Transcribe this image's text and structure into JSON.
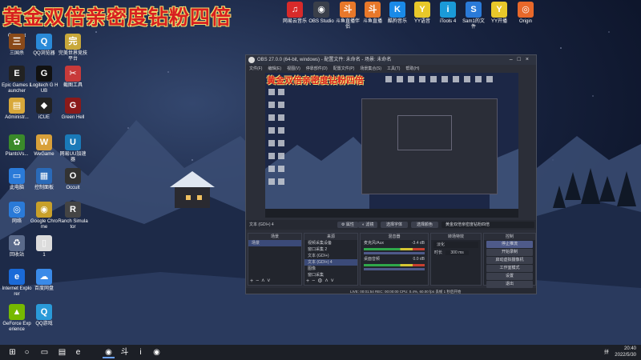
{
  "overlay_title": "黄金双倍亲密度钻粉四倍",
  "desktop_left": [
    {
      "label": "Connect",
      "icon": "connect-icon",
      "glyph": "",
      "color": "#3a3f4a"
    },
    {
      "label": "三国杀",
      "icon": "sanguosha-icon",
      "glyph": "三",
      "color": "#8a4a1a"
    },
    {
      "label": "QQ浏览器",
      "icon": "qq-browser-icon",
      "glyph": "Q",
      "color": "#2a8ad8"
    },
    {
      "label": "完美世界竞技平台",
      "icon": "perfect-world-icon",
      "glyph": "完",
      "color": "#c8a83a"
    },
    {
      "label": "Epic Games Launcher",
      "icon": "epic-games-icon",
      "glyph": "E",
      "color": "#222"
    },
    {
      "label": "Logitech G HUB",
      "icon": "logitech-ghub-icon",
      "glyph": "G",
      "color": "#111"
    },
    {
      "label": "截图工具",
      "icon": "snipping-tool-icon",
      "glyph": "✂",
      "color": "#c83a3a"
    },
    {
      "label": "Administr...",
      "icon": "user-folder-icon",
      "glyph": "▤",
      "color": "#d8a83a"
    },
    {
      "label": "iCUE",
      "icon": "icue-icon",
      "glyph": "◆",
      "color": "#222"
    },
    {
      "label": "Green Hell",
      "icon": "green-hell-icon",
      "glyph": "G",
      "color": "#8a1a1a"
    },
    {
      "label": "PlantsVs...",
      "icon": "plants-vs-zombies-icon",
      "glyph": "✿",
      "color": "#3a8a2a"
    },
    {
      "label": "WeGame",
      "icon": "wegame-icon",
      "glyph": "W",
      "color": "#d8a03a"
    },
    {
      "label": "网易UU加速器",
      "icon": "uu-accelerator-icon",
      "glyph": "U",
      "color": "#1a7ab8"
    },
    {
      "label": "此电脑",
      "icon": "this-pc-icon",
      "glyph": "▭",
      "color": "#2a7ad8"
    },
    {
      "label": "控制面板",
      "icon": "control-panel-icon",
      "glyph": "▦",
      "color": "#2a6ab8"
    },
    {
      "label": "Occult",
      "icon": "occult-icon",
      "glyph": "O",
      "color": "#333"
    },
    {
      "label": "网络",
      "icon": "network-icon",
      "glyph": "◎",
      "color": "#2a7ad8"
    },
    {
      "label": "Google Chrome",
      "icon": "chrome-icon",
      "glyph": "◉",
      "color": "#c8a02a"
    },
    {
      "label": "Ranch Simulator",
      "icon": "ranch-simulator-icon",
      "glyph": "R",
      "color": "#444"
    },
    {
      "label": "回收站",
      "icon": "recycle-bin-icon",
      "glyph": "♻",
      "color": "#5a6a8a"
    },
    {
      "label": "1",
      "icon": "file-icon",
      "glyph": "▯",
      "color": "#dcdcdc"
    },
    {
      "label": "Internet Explorer",
      "icon": "internet-explorer-icon",
      "glyph": "e",
      "color": "#1a6ad8"
    },
    {
      "label": "百度网盘",
      "icon": "baidu-netdisk-icon",
      "glyph": "☁",
      "color": "#3a8ae8"
    },
    {
      "label": "GeForce Experience",
      "icon": "geforce-icon",
      "glyph": "▲",
      "color": "#76b900"
    },
    {
      "label": "QQ游戏",
      "icon": "qq-game-icon",
      "glyph": "Q",
      "color": "#2a9ad8"
    }
  ],
  "desktop_top": [
    {
      "label": "网易云音乐",
      "icon": "netease-music-icon",
      "glyph": "♫",
      "color": "#d82a2a"
    },
    {
      "label": "OBS Studio",
      "icon": "obs-icon",
      "glyph": "◉",
      "color": "#3a3f4a"
    },
    {
      "label": "斗鱼直播伴侣",
      "icon": "douyu-companion-icon",
      "glyph": "斗",
      "color": "#e8782a"
    },
    {
      "label": "斗鱼直播",
      "icon": "douyu-icon",
      "glyph": "斗",
      "color": "#e8782a"
    },
    {
      "label": "酷狗音乐",
      "icon": "kugou-icon",
      "glyph": "K",
      "color": "#1a8ae8"
    },
    {
      "label": "YY语音",
      "icon": "yy-icon",
      "glyph": "Y",
      "color": "#e8c82a"
    },
    {
      "label": "iTools 4",
      "icon": "itools-icon",
      "glyph": "i",
      "color": "#1a9ad8"
    },
    {
      "label": "Sam1的文件",
      "icon": "sam-files-icon",
      "glyph": "S",
      "color": "#2a7ad8"
    },
    {
      "label": "YY开播",
      "icon": "yy-live-icon",
      "glyph": "Y",
      "color": "#e8c82a"
    },
    {
      "label": "Origin",
      "icon": "origin-icon",
      "glyph": "◎",
      "color": "#e8682a"
    }
  ],
  "obs": {
    "window_title": "OBS 27.0.0 (64-bit, windows) - 配置文件: 未命名 - 场景: 未命名",
    "menu": [
      "文件(F)",
      "编辑(E)",
      "视图(V)",
      "停靠部件(D)",
      "配置文件(P)",
      "场景集合(S)",
      "工具(T)",
      "帮助(H)"
    ],
    "preview_title": "黄金双倍亲密度钻粉四倍",
    "source_label": "文本 (GDI+) 4",
    "props_button": "属性",
    "filters_button": "滤镜",
    "select_font": "选择字体",
    "select_color": "选择颜色",
    "text_value": "黄金双倍亲密度钻粉四倍",
    "docks": {
      "scenes": {
        "title": "场景",
        "items": [
          "场景"
        ]
      },
      "sources": {
        "title": "来源",
        "items": [
          "视频采集设备",
          "窗口采集 2",
          "文本 (GDI+)",
          "文本 (GDI+) 4",
          "图像",
          "窗口采集"
        ]
      },
      "mixer": {
        "title": "混音器",
        "tracks": [
          {
            "name": "麦克风/Aux",
            "level": "-3.4 dB"
          },
          {
            "name": "桌面音频",
            "level": "0.0 dB"
          }
        ]
      },
      "transitions": {
        "title": "转场特效",
        "type": "淡化",
        "duration_label": "时长",
        "duration": "300 ms"
      },
      "controls": {
        "title": "控制",
        "buttons": [
          "停止推流",
          "开始录制",
          "启动虚拟摄像机",
          "工作室模式",
          "设置",
          "退出"
        ]
      }
    },
    "statusbar": "LIVE: 00:01:54   REC: 00:00:00   CPU: 0.4%, 60.00 fps   丢帧 1 秒后开始"
  },
  "taskbar": {
    "apps": [
      {
        "icon": "start-icon",
        "glyph": "⊞"
      },
      {
        "icon": "search-icon",
        "glyph": "○"
      },
      {
        "icon": "task-view-icon",
        "glyph": "▭"
      },
      {
        "icon": "file-explorer-icon",
        "glyph": "▤"
      },
      {
        "icon": "edge-icon",
        "glyph": "e"
      },
      {
        "icon": "obs-taskbar-icon",
        "glyph": "◉"
      },
      {
        "icon": "douyu-taskbar-icon",
        "glyph": "斗"
      },
      {
        "icon": "itools-taskbar-icon",
        "glyph": "i"
      },
      {
        "icon": "chrome-taskbar-icon",
        "glyph": "◉"
      }
    ],
    "lang": "拼",
    "time": "20:40",
    "date": "2022/5/30"
  }
}
